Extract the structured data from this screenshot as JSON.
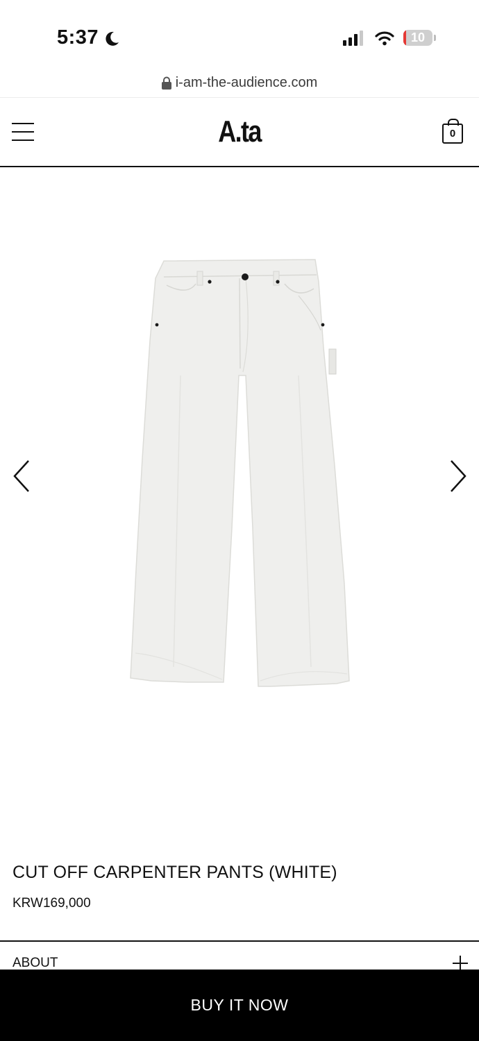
{
  "status": {
    "time": "5:37",
    "battery_level": "10",
    "battery_fraction": 0.1,
    "icons": [
      "moon-icon",
      "cellular-signal-icon",
      "wifi-icon",
      "battery-icon"
    ]
  },
  "browser": {
    "url": "i-am-the-audience.com"
  },
  "header": {
    "logo": "A.ta",
    "cart_count": "0"
  },
  "product": {
    "image_subject": "white carpenter pants",
    "title": "CUT OFF CARPENTER PANTS (WHITE)",
    "price": "KRW169,000"
  },
  "accordion": {
    "about_label": "ABOUT"
  },
  "cta": {
    "buy_label": "BUY IT NOW"
  },
  "colors": {
    "background": "#ffffff",
    "text": "#111111",
    "buy_bar": "#000000",
    "battery_low": "#e53935"
  }
}
